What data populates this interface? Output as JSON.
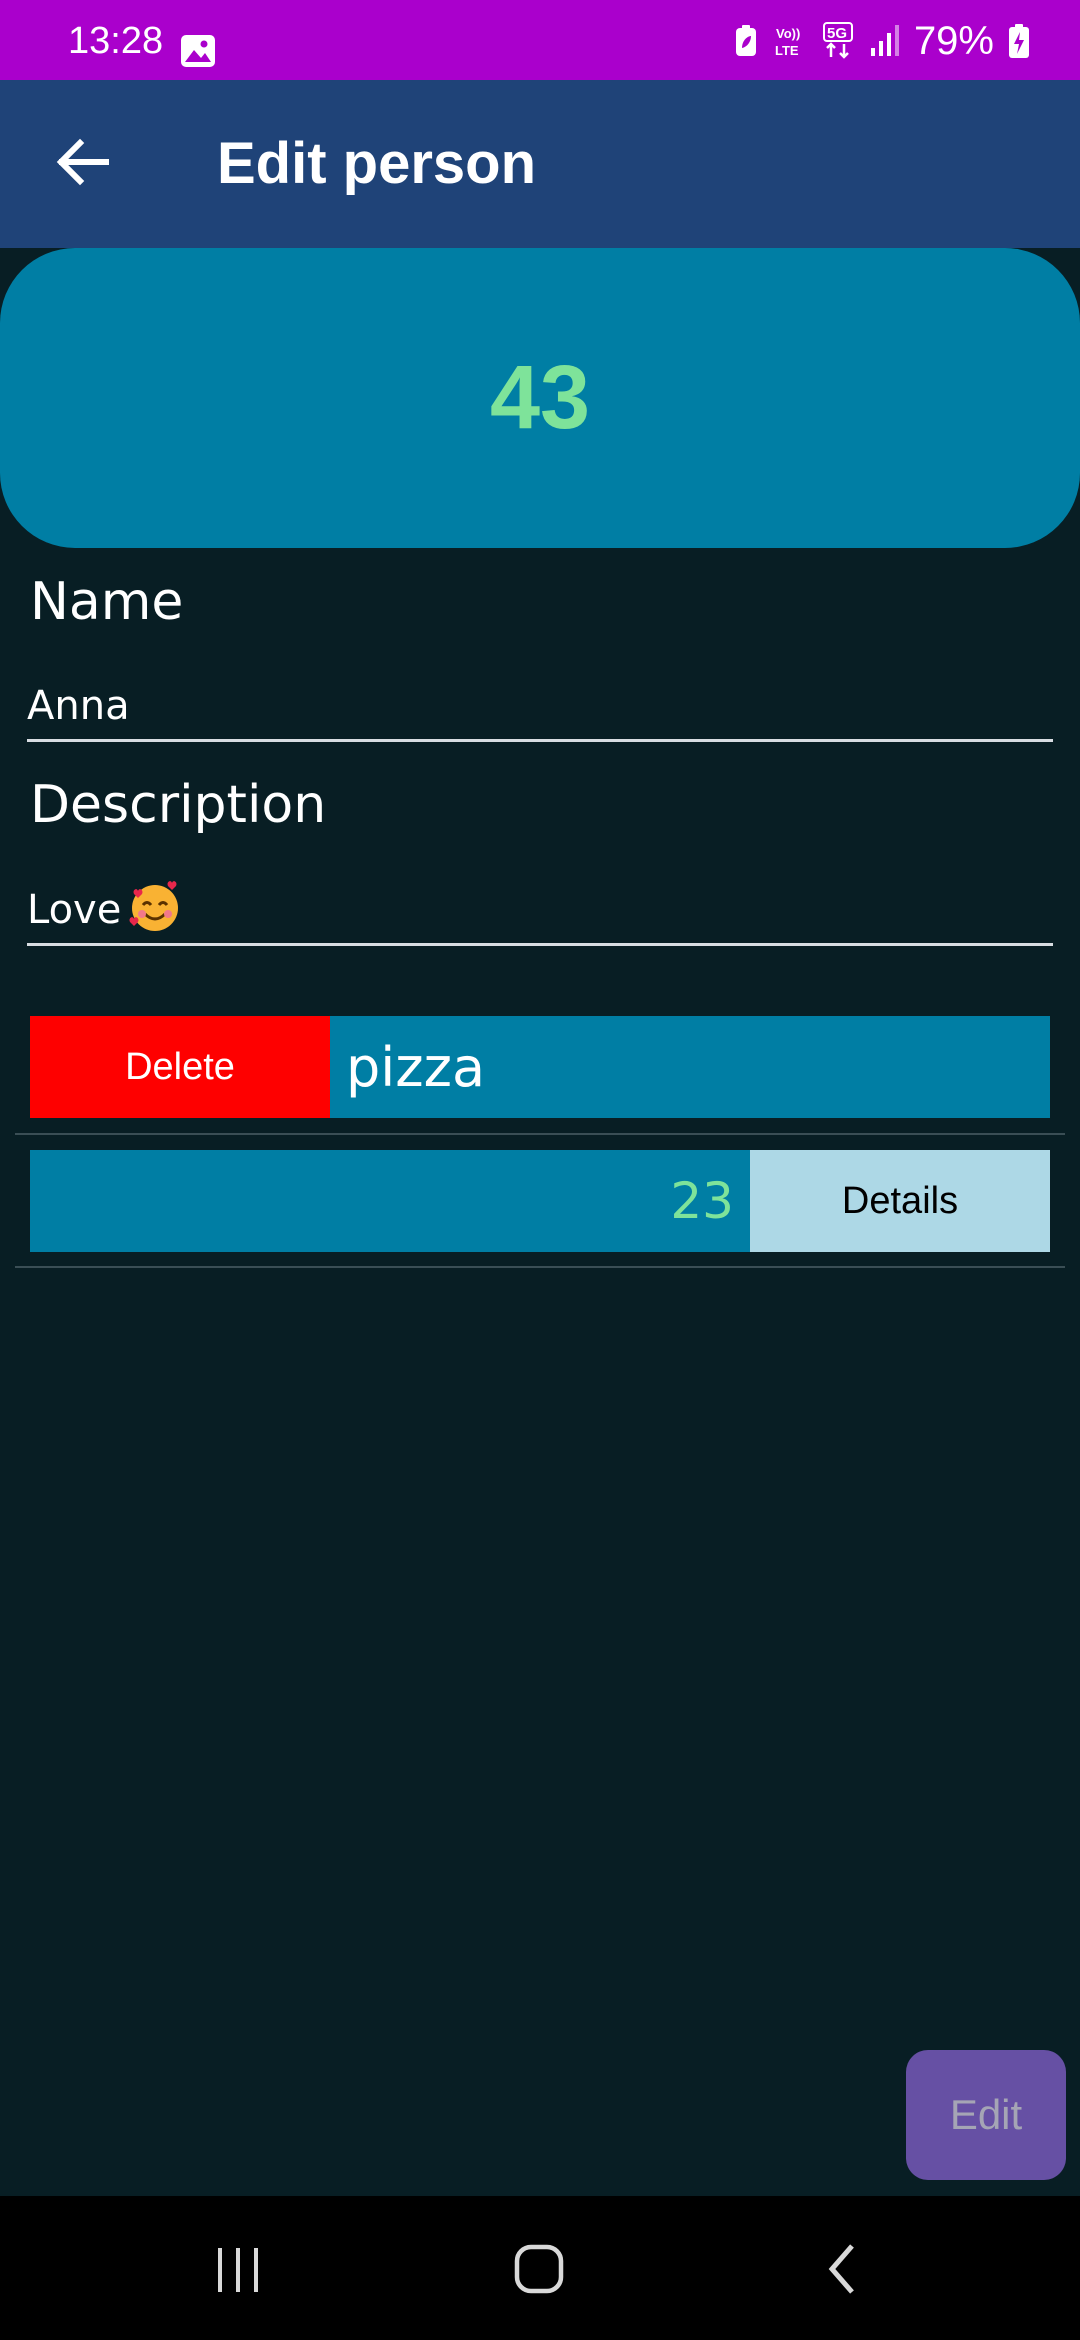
{
  "status_bar": {
    "time": "13:28",
    "battery": "79%",
    "icons": [
      "gallery-icon",
      "battery-saver-icon",
      "volte-icon",
      "5g-icon",
      "signal-icon",
      "battery-charging-icon"
    ]
  },
  "app_bar": {
    "title": "Edit person",
    "back_icon": "arrow-back-icon"
  },
  "score": "43",
  "form": {
    "name_label": "Name",
    "name_value": "Anna",
    "description_label": "Description",
    "description_value": "Love",
    "description_emoji": "smiling-face-with-hearts"
  },
  "items": [
    {
      "delete_label": "Delete",
      "name": "pizza"
    },
    {
      "value": "23",
      "details_label": "Details"
    }
  ],
  "fab": {
    "label": "Edit"
  },
  "nav_bar": {
    "icons": [
      "recents-icon",
      "home-icon",
      "back-icon"
    ]
  },
  "colors": {
    "status_bar": "#aa00cc",
    "app_bar": "#1f4378",
    "background": "#081e24",
    "card": "#007ea4",
    "accent_green": "#7ee39a",
    "delete": "#fe0000",
    "details": "#add8e6",
    "fab": "#6650a4"
  }
}
